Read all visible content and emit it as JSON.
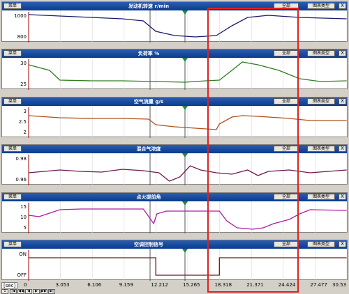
{
  "buttons": {
    "menu": "菜单",
    "all": "全部",
    "type": "图表类型",
    "close": "X"
  },
  "panels": [
    {
      "title": "发动机转速 r/min",
      "yticks": [
        "1000",
        "800"
      ],
      "color": "#1a1a6e"
    },
    {
      "title": "负荷率 %",
      "yticks": [
        "30",
        "25"
      ],
      "color": "#2e7d1e"
    },
    {
      "title": "空气流量 g/s",
      "yticks": [
        "3",
        "2.5",
        "2"
      ],
      "color": "#b0501a"
    },
    {
      "title": "混合气浓度",
      "yticks": [
        "0.98",
        "0.96"
      ],
      "color": "#6e1a4e"
    },
    {
      "title": "点火提前角",
      "yticks": [
        "15",
        "10",
        "5"
      ],
      "color": "#b01aa0"
    },
    {
      "title": "空调控制信号",
      "yticks": [
        "ON",
        "OFF"
      ],
      "color": "#6e1a1a"
    }
  ],
  "time_axis": {
    "unit": "[sec]",
    "ticks": [
      "0",
      "3.053",
      "6.106",
      "9.159",
      "12.212",
      "15.265",
      "18.318",
      "21.371",
      "24.424",
      "27.477",
      "30.53"
    ]
  },
  "nav": {
    "page": "1",
    "buttons": [
      "|◀",
      "◀◀",
      "◀",
      "▶",
      "▶▶",
      "▶|"
    ]
  },
  "colors": {
    "header": "#1a4ca0",
    "highlight": "#e02020",
    "marker": "#1e8a3a"
  }
}
